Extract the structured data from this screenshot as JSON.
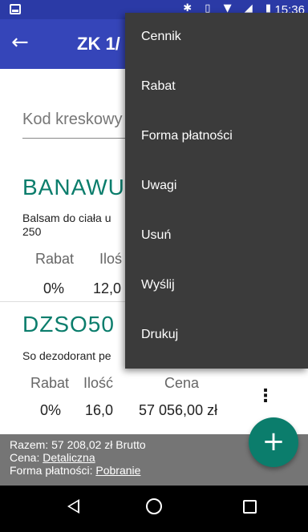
{
  "status_bar": {
    "icons": "✱ ▯ ▼ ◢ ▮",
    "time": "15:36"
  },
  "app_bar": {
    "title": "ZK 1/",
    "back_icon": "←"
  },
  "barcode": {
    "placeholder": "Kod kreskowy"
  },
  "items": [
    {
      "code": "BANAWUL",
      "description_line1": "Balsam do ciała u",
      "description_line2": "250",
      "rabat_label": "Rabat",
      "ilosc_label": "Iloś",
      "rabat_value": "0%",
      "ilosc_value": "12,0"
    },
    {
      "code": "DZSO50",
      "description_line1": "So dezodorant pe",
      "rabat_label": "Rabat",
      "ilosc_label": "Ilość",
      "cena_label": "Cena",
      "rabat_value": "0%",
      "ilosc_value": "16,0",
      "cena_value": "57 056,00 zł"
    }
  ],
  "kebab_icon": "⋮",
  "footer": {
    "total": "Razem: 57 208,02 zł Brutto",
    "price_label": "Cena: ",
    "price_value": "Detaliczna",
    "payment_label": "Forma płatności: ",
    "payment_value": "Pobranie"
  },
  "fab_icon": "+",
  "menu": {
    "items": [
      "Cennik",
      "Rabat",
      "Forma płatności",
      "Uwagi",
      "Usuń",
      "Wyślij",
      "Drukuj"
    ]
  },
  "colors": {
    "status_bar": "#2b3aa6",
    "app_bar": "#3545b9",
    "accent": "#0b7d6c",
    "menu_bg": "#3b3b3b",
    "footer_bg": "#757575"
  }
}
